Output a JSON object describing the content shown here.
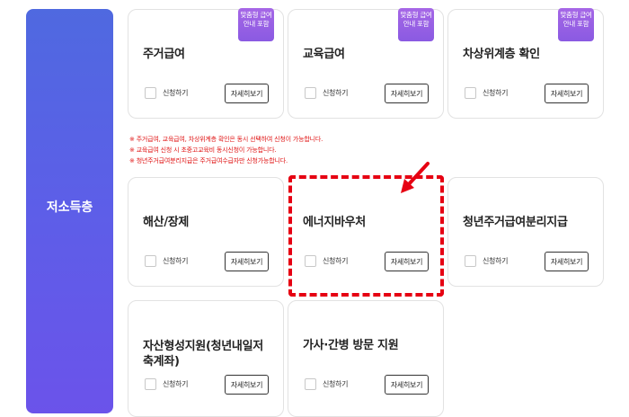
{
  "category": {
    "label": "저소득층"
  },
  "badge_text": "맞춤형 급여안내 포함",
  "apply_label": "신청하기",
  "detail_label": "자세히보기",
  "cards": [
    {
      "title": "주거급여",
      "badge": true
    },
    {
      "title": "교육급여",
      "badge": true
    },
    {
      "title": "차상위계층 확인",
      "badge": true
    },
    {
      "title": "해산/장제",
      "badge": false
    },
    {
      "title": "에너지바우처",
      "badge": false,
      "highlighted": true
    },
    {
      "title": "청년주거급여분리지급",
      "badge": false
    },
    {
      "title": "자산형성지원(청년내일저축계좌)",
      "badge": false
    },
    {
      "title": "가사·간병 방문 지원",
      "badge": false
    }
  ],
  "notes": [
    "※ 주거급여, 교육급여, 차상위계층 확인은 동시 선택하여 신청이 가능합니다.",
    "※ 교육급여 신청 시 초중고교육비 동시신청이 가능합니다.",
    "※ 청년주거급여분리지급은 주거급여수급자만 신청가능합니다."
  ],
  "colors": {
    "sidebar": "#5a5fe6",
    "badge": "#9b63e4",
    "highlight": "#e60012",
    "note": "#e01515"
  }
}
